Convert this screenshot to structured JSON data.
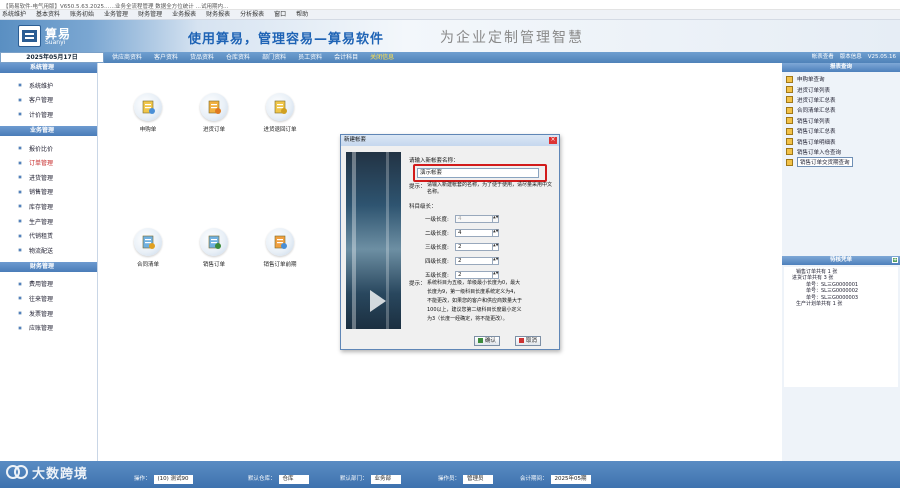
{
  "window": {
    "title": "【简易软件-电气用版】V650.5.63.2025……业务全流程管理 数据全方位统计 …试用期内…"
  },
  "menu": [
    "系统维护",
    "基本资料",
    "账务初始",
    "业务管理",
    "财务管理",
    "业务报表",
    "财务报表",
    "分析报表",
    "窗口",
    "帮助"
  ],
  "banner": {
    "logo_main": "算易",
    "logo_sub": "Suanyi",
    "slogan": "使用算易，管理容易—算易软件",
    "slogan2": "为企业定制管理智慧"
  },
  "nav": {
    "date": "2025年05月17日",
    "tabs": [
      "供应商资料",
      "客户资料",
      "货品资料",
      "仓库资料",
      "部门资料",
      "员工资料",
      "会计科目",
      "关闭信息"
    ],
    "active_tab": "关闭信息",
    "right": [
      "帐表查看",
      "版本信息",
      "V25.05.16"
    ]
  },
  "sidebar": {
    "sections": [
      {
        "title": "系统管理",
        "items": [
          {
            "label": "系统维护"
          },
          {
            "label": "客户管理"
          },
          {
            "label": "计价管理"
          }
        ]
      },
      {
        "title": "业务管理",
        "items": [
          {
            "label": "报价比价"
          },
          {
            "label": "订单管理",
            "active": true
          },
          {
            "label": "进货管理"
          },
          {
            "label": "销售管理"
          },
          {
            "label": "库存管理"
          },
          {
            "label": "生产管理"
          },
          {
            "label": "代销租赁"
          },
          {
            "label": "物流配送"
          }
        ]
      },
      {
        "title": "财务管理",
        "items": [
          {
            "label": "费用管理"
          },
          {
            "label": "往来管理"
          },
          {
            "label": "发票管理"
          },
          {
            "label": "应账管理"
          }
        ]
      }
    ]
  },
  "workflow": {
    "row1": [
      {
        "label": "申购单",
        "icon": "docs-icon"
      },
      {
        "label": "进货订单",
        "icon": "cart-doc-icon"
      },
      {
        "label": "进货退回订单",
        "icon": "return-doc-icon"
      }
    ],
    "row2": [
      {
        "label": "合同清单",
        "icon": "contract-icon"
      },
      {
        "label": "销售订单",
        "icon": "sales-doc-icon"
      },
      {
        "label": "销售订单前期",
        "icon": "presale-doc-icon"
      }
    ]
  },
  "reports": {
    "header": "报表查询",
    "items": [
      "申购单查询",
      "进货订单列表",
      "进货订单汇总表",
      "合同清单汇总表",
      "销售订单列表",
      "销售订单汇总表",
      "销售订单明细表",
      "销售订单入仓查询",
      "销售订单交货期查询"
    ],
    "selected": "销售订单交货期查询"
  },
  "voucher": {
    "header": "待核凭单",
    "lines": [
      "销售订单共有 1 张",
      "进货订单共有 3 张",
      "单号：SL三G0000001",
      "单号：SL三G0000002",
      "单号：SL三G0000003",
      "生产计划单共有 1 张"
    ]
  },
  "status": {
    "operator_label": "操作：",
    "operator": "(10) 测试90",
    "warehouse_label": "默认仓库：",
    "warehouse": "仓库",
    "dept_label": "默认部门：",
    "dept": "业务部",
    "user_label": "操作员：",
    "user": "管理员",
    "period_label": "会计期间：",
    "period": "2025年05期"
  },
  "watermark": "大数跨境",
  "dialog": {
    "title": "新建帐套",
    "prompt": "请输入新帐套名称：",
    "name_value": "演示帐套",
    "hint_label": "提示：",
    "hint_text": "请输入新建帐套的名称，为了便于使用，请尽量采用中文名称。",
    "levels_title": "科目级长：",
    "levels": [
      {
        "label": "一级长度:",
        "value": "4",
        "disabled": true
      },
      {
        "label": "二级长度:",
        "value": "4",
        "disabled": false
      },
      {
        "label": "三级长度:",
        "value": "2",
        "disabled": false
      },
      {
        "label": "四级长度:",
        "value": "2",
        "disabled": false
      },
      {
        "label": "五级长度:",
        "value": "2",
        "disabled": false
      }
    ],
    "notes_label": "提示：",
    "notes": [
      "系统科目为五级，单级最小长度为0，最大",
      "长度为9，第一级科目长度系统定义为4，",
      "不能更改，如果您的客户和供应商数量大于",
      "100以上，建议您第二级科目长度最小定义",
      "为3（长度一经确定，将不能更改）。"
    ],
    "ok": "确认",
    "cancel": "取消"
  }
}
